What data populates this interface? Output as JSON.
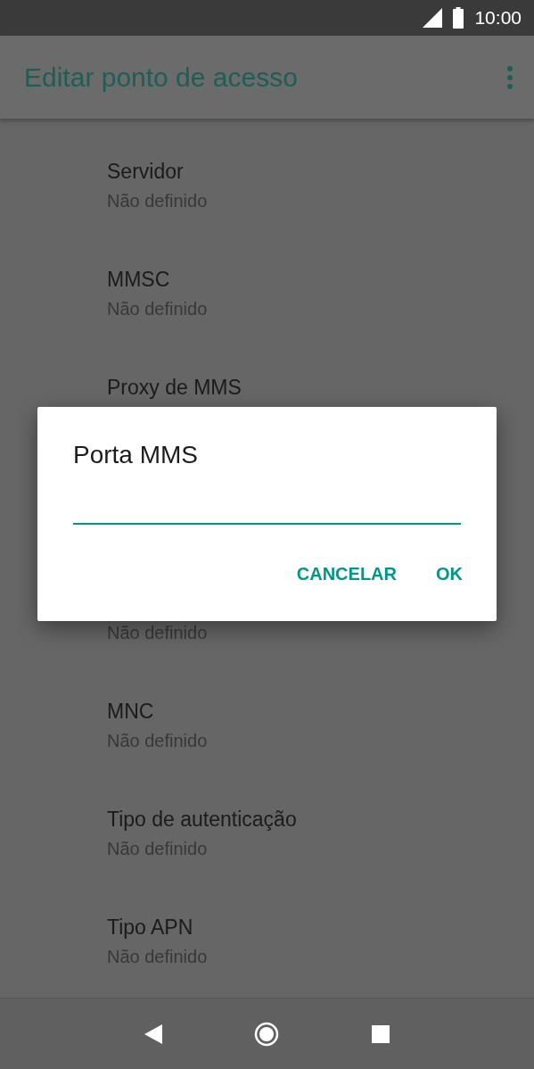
{
  "status_bar": {
    "time": "10:00"
  },
  "app_bar": {
    "title": "Editar ponto de acesso"
  },
  "settings": [
    {
      "kind": "row",
      "title": "Servidor",
      "subtitle": "Não definido"
    },
    {
      "kind": "row",
      "title": "MMSC",
      "subtitle": "Não definido"
    },
    {
      "kind": "row",
      "title": "Proxy de MMS"
    },
    {
      "kind": "covered"
    },
    {
      "kind": "row",
      "subtitle": "Não definido"
    },
    {
      "kind": "row",
      "title": "MNC",
      "subtitle": "Não definido"
    },
    {
      "kind": "row",
      "title": "Tipo de autenticação",
      "subtitle": "Não definido"
    },
    {
      "kind": "row",
      "title": "Tipo APN",
      "subtitle": "Não definido"
    }
  ],
  "dialog": {
    "title": "Porta MMS",
    "buttons": [
      "CANCELAR",
      "OK"
    ]
  }
}
